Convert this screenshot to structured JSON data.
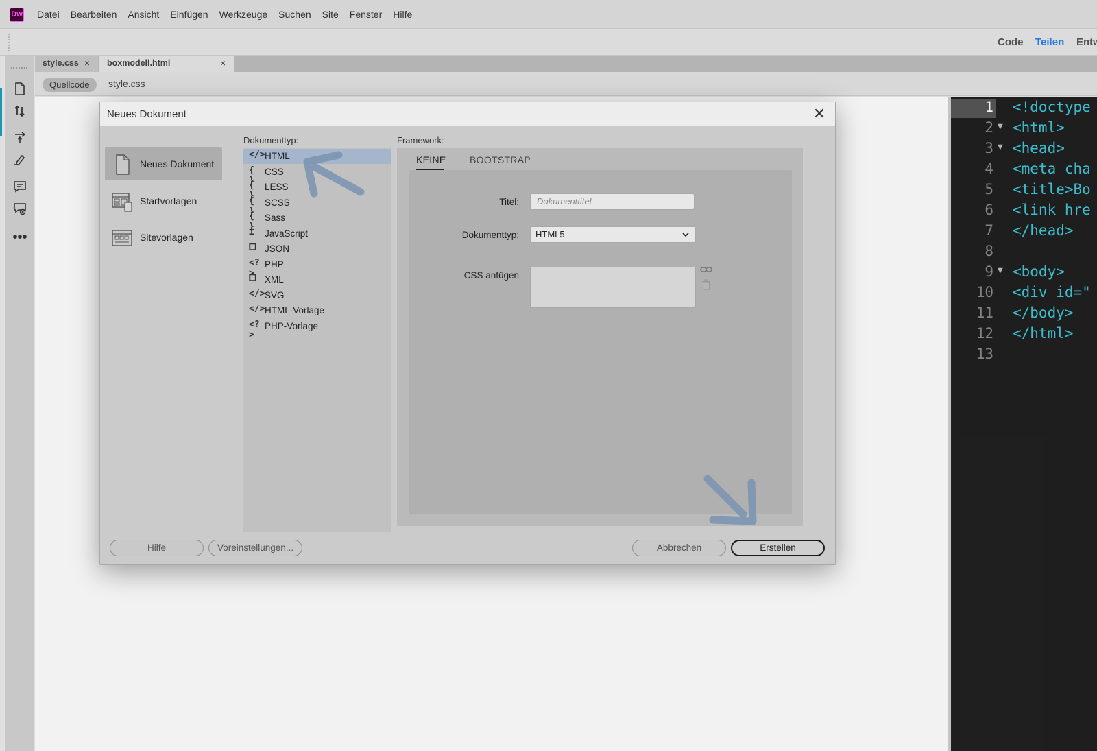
{
  "app": {
    "logo": "Dw"
  },
  "menubar": {
    "items": [
      {
        "label": "Datei"
      },
      {
        "label": "Bearbeiten"
      },
      {
        "label": "Ansicht"
      },
      {
        "label": "Einfügen"
      },
      {
        "label": "Werkzeuge"
      },
      {
        "label": "Suchen"
      },
      {
        "label": "Site"
      },
      {
        "label": "Fenster"
      },
      {
        "label": "Hilfe"
      }
    ]
  },
  "viewbar": {
    "code": "Code",
    "split": "Teilen",
    "design": "Entw"
  },
  "tabs": [
    {
      "label": "style.css",
      "close": "×"
    },
    {
      "label": "boxmodell.html",
      "close": "×"
    }
  ],
  "related_files": {
    "source": "Quellcode",
    "file": "style.css"
  },
  "code_view": {
    "lines": [
      {
        "n": "1",
        "code": "<!doctype",
        "fold": ""
      },
      {
        "n": "2",
        "code": "<html>",
        "fold": "▼"
      },
      {
        "n": "3",
        "code": "<head>",
        "fold": "▼"
      },
      {
        "n": "4",
        "code": "<meta cha",
        "fold": ""
      },
      {
        "n": "5",
        "code": "<title>Bo",
        "fold": ""
      },
      {
        "n": "6",
        "code": "<link hre",
        "fold": ""
      },
      {
        "n": "7",
        "code": "</head>",
        "fold": ""
      },
      {
        "n": "8",
        "code": "",
        "fold": ""
      },
      {
        "n": "9",
        "code": "<body>",
        "fold": "▼"
      },
      {
        "n": "10",
        "code": "<div id=\"",
        "fold": ""
      },
      {
        "n": "11",
        "code": "</body>",
        "fold": ""
      },
      {
        "n": "12",
        "code": "</html>",
        "fold": ""
      },
      {
        "n": "13",
        "code": "",
        "fold": ""
      }
    ]
  },
  "dialog": {
    "title": "Neues Dokument",
    "close": "✕",
    "categories": [
      {
        "label": "Neues Dokument",
        "icon": "document-icon"
      },
      {
        "label": "Startvorlagen",
        "icon": "starter-templates-icon"
      },
      {
        "label": "Sitevorlagen",
        "icon": "site-templates-icon"
      }
    ],
    "doctype_label": "Dokumenttyp:",
    "doctypes": [
      {
        "icon": "</>",
        "label": "HTML"
      },
      {
        "icon": "{ }",
        "label": "CSS"
      },
      {
        "icon": "{ }",
        "label": "LESS"
      },
      {
        "icon": "{ }",
        "label": "SCSS"
      },
      {
        "icon": "{ }",
        "label": "Sass"
      },
      {
        "icon": "⌶",
        "label": "JavaScript"
      },
      {
        "icon": "⧠",
        "label": "JSON"
      },
      {
        "icon": "<?>",
        "label": "PHP"
      },
      {
        "icon": "⧠",
        "label": "XML"
      },
      {
        "icon": "</>",
        "label": "SVG"
      },
      {
        "icon": "</>",
        "label": "HTML-Vorlage"
      },
      {
        "icon": "<?>",
        "label": "PHP-Vorlage"
      }
    ],
    "framework_label": "Framework:",
    "framework_tabs": [
      {
        "label": "KEINE"
      },
      {
        "label": "BOOTSTRAP"
      }
    ],
    "form": {
      "title_label": "Titel:",
      "title_placeholder": "Dokumenttitel",
      "doctype_label": "Dokumenttyp:",
      "doctype_value": "HTML5",
      "css_label": "CSS anfügen"
    },
    "buttons": {
      "help": "Hilfe",
      "preferences": "Voreinstellungen...",
      "cancel": "Abbrechen",
      "create": "Erstellen"
    }
  },
  "colors": {
    "accent": "#2680eb",
    "selection": "#a4b5cc",
    "annotation_arrow": "#7d95b3",
    "code_tag": "#3fc6d8",
    "code_bg": "#1e1e1e"
  }
}
